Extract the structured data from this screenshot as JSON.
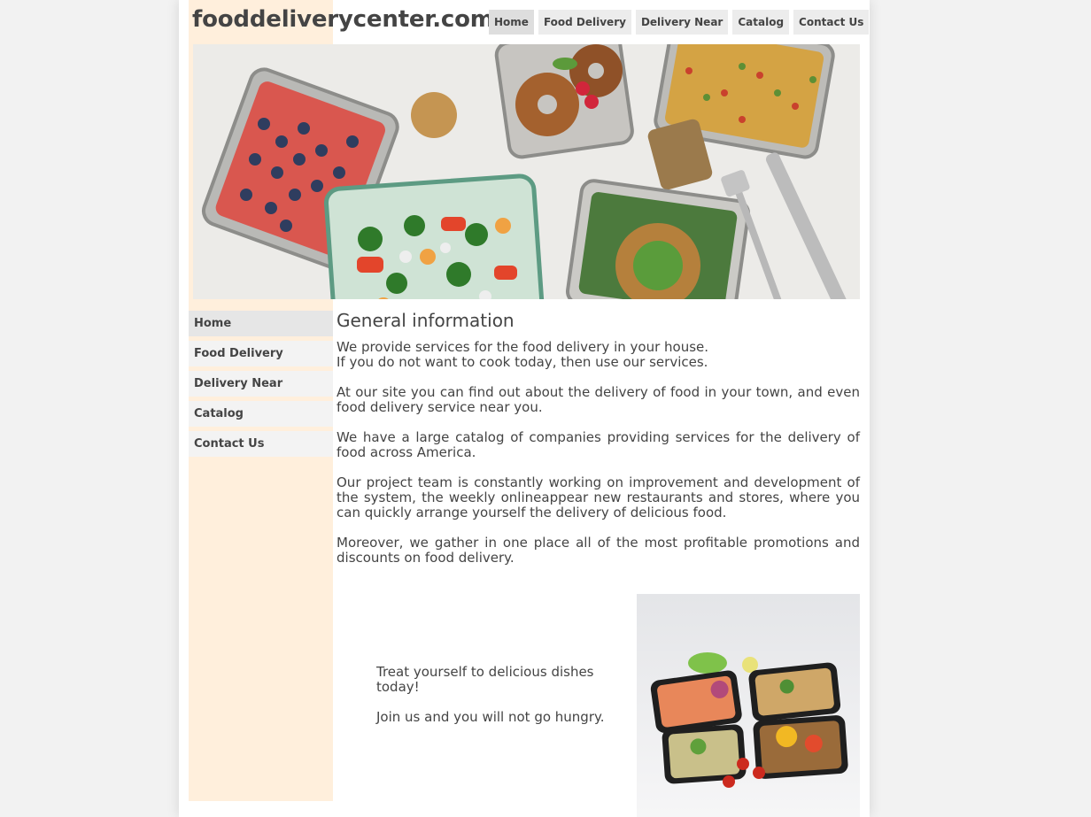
{
  "site": {
    "title": "fooddeliverycenter.com"
  },
  "topnav": [
    {
      "label": "Home"
    },
    {
      "label": "Food Delivery"
    },
    {
      "label": "Delivery Near"
    },
    {
      "label": "Catalog"
    },
    {
      "label": "Contact Us"
    }
  ],
  "sidenav": [
    {
      "label": "Home"
    },
    {
      "label": "Food Delivery"
    },
    {
      "label": "Delivery Near"
    },
    {
      "label": "Catalog"
    },
    {
      "label": "Contact Us"
    }
  ],
  "main": {
    "heading": "General information",
    "paragraph_1_line_1": "We provide services for the food delivery in your house.",
    "paragraph_1_line_2": "If you do not want to cook today, then use our services.",
    "paragraph_2": "At our site you can find out about the delivery of food in your town, and even food delivery service near you.",
    "paragraph_3": "We have a large catalog of companies providing services for the delivery of food across America.",
    "paragraph_4": "Our project team is constantly working on improvement and development of the system, the weekly onlineappear new restaurants and stores, where you can quickly arrange yourself the delivery of delicious food.",
    "paragraph_5": "Moreover, we gather in one place all of the most profitable promotions and discounts on food delivery."
  },
  "promo": {
    "line_1": "Treat yourself to delicious dishes today!",
    "line_2": "Join us and you will not go hungry."
  },
  "colors": {
    "page_background": "#f2f2f2",
    "sidebar": "#ffefdc",
    "nav_button": "#ececec",
    "text": "#444444"
  }
}
